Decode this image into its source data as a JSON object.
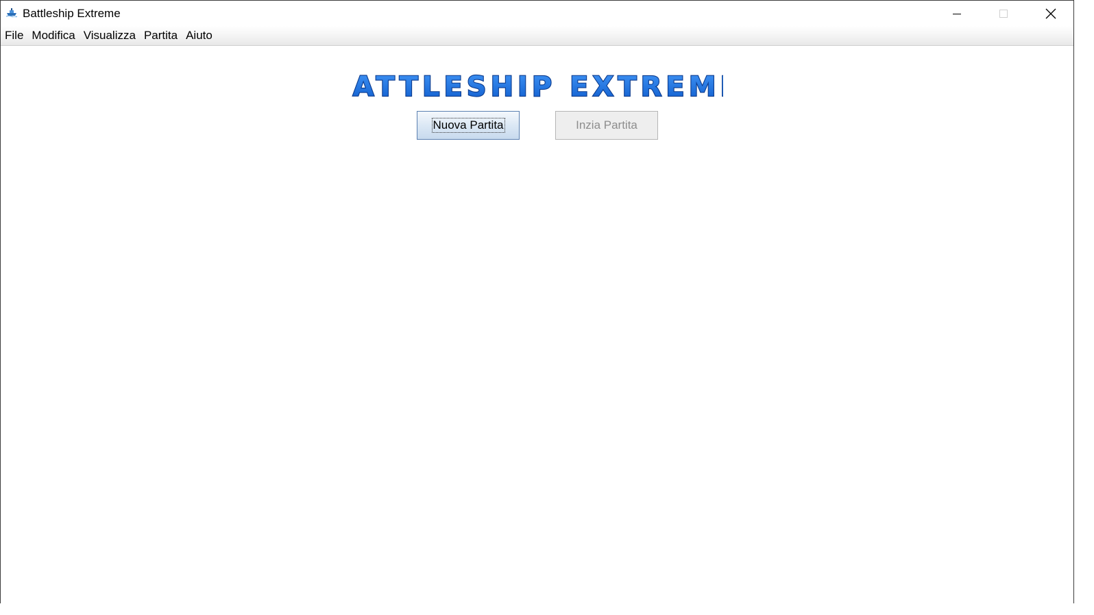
{
  "window": {
    "title": "Battleship Extreme",
    "icon": "ship-icon",
    "controls": [
      "minimize-icon",
      "maximize-icon",
      "close-icon"
    ]
  },
  "menubar": {
    "items": [
      {
        "label": "File"
      },
      {
        "label": "Modifica"
      },
      {
        "label": "Visualizza"
      },
      {
        "label": "Partita"
      },
      {
        "label": "Aiuto"
      }
    ]
  },
  "main": {
    "logo_text": "BATTLESHIP EXTREME",
    "buttons": {
      "new_game": "Nuova Partita",
      "start_game": "Inzia Partita"
    }
  },
  "colors": {
    "logo_fill": "#1a6fe0",
    "logo_stroke": "#0b3a8c",
    "button_focus_border": "#5a7fb0",
    "button_disabled_text": "#8d8d8d"
  }
}
